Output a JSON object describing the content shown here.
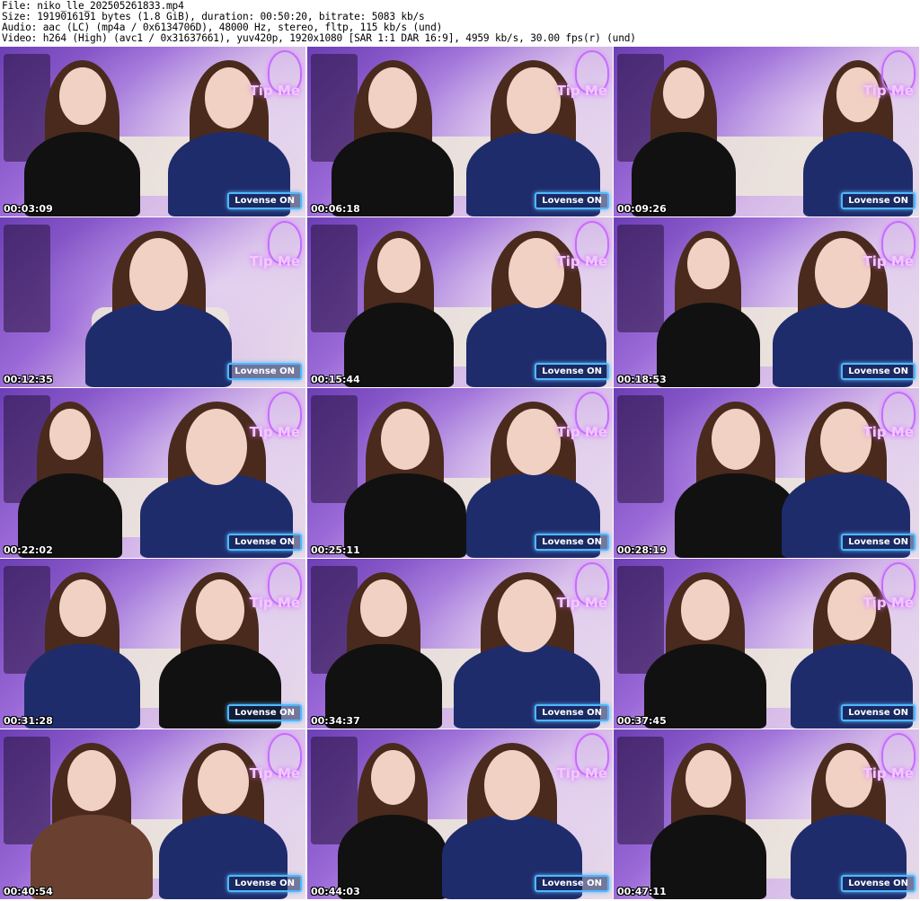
{
  "header": {
    "file": "File: niko_lle_202505261833.mp4",
    "size": "Size: 1919016191 bytes (1.8 GiB), duration: 00:50:20, bitrate: 5083 kb/s",
    "audio": "Audio: aac (LC) (mp4a / 0x6134706D), 48000 Hz, stereo, fltp, 115 kb/s (und)",
    "video": "Video: h264 (High) (avc1 / 0x31637661), yuv420p, 1920x1080 [SAR 1:1 DAR 16:9], 4959 kb/s, 30.00 fps(r) (und)"
  },
  "thumbnails": [
    {
      "timestamp": "00:03:09",
      "tip": "Tip Me",
      "lovense": "Lovense ON"
    },
    {
      "timestamp": "00:06:18",
      "tip": "Tip Me",
      "lovense": "Lovense ON"
    },
    {
      "timestamp": "00:09:26",
      "tip": "Tip Me",
      "lovense": "Lovense ON"
    },
    {
      "timestamp": "00:12:35",
      "tip": "Tip Me",
      "lovense": "Lovense ON"
    },
    {
      "timestamp": "00:15:44",
      "tip": "Tip Me",
      "lovense": "Lovense ON"
    },
    {
      "timestamp": "00:18:53",
      "tip": "Tip Me",
      "lovense": "Lovense ON"
    },
    {
      "timestamp": "00:22:02",
      "tip": "Tip Me",
      "lovense": "Lovense ON"
    },
    {
      "timestamp": "00:25:11",
      "tip": "Tip Me",
      "lovense": "Lovense ON"
    },
    {
      "timestamp": "00:28:19",
      "tip": "Tip Me",
      "lovense": "Lovense ON"
    },
    {
      "timestamp": "00:31:28",
      "tip": "Tip Me",
      "lovense": "Lovense ON"
    },
    {
      "timestamp": "00:34:37",
      "tip": "Tip Me",
      "lovense": "Lovense ON"
    },
    {
      "timestamp": "00:37:45",
      "tip": "Tip Me",
      "lovense": "Lovense ON"
    },
    {
      "timestamp": "00:40:54",
      "tip": "Tip Me",
      "lovense": "Lovense ON"
    },
    {
      "timestamp": "00:44:03",
      "tip": "Tip Me",
      "lovense": "Lovense ON"
    },
    {
      "timestamp": "00:47:11",
      "tip": "Tip Me",
      "lovense": "Lovense ON"
    }
  ],
  "colors": {
    "neon_purple": "#c56cff",
    "lovense_blue": "#4fb8ff",
    "wall_purple": "#9b6ad8"
  }
}
